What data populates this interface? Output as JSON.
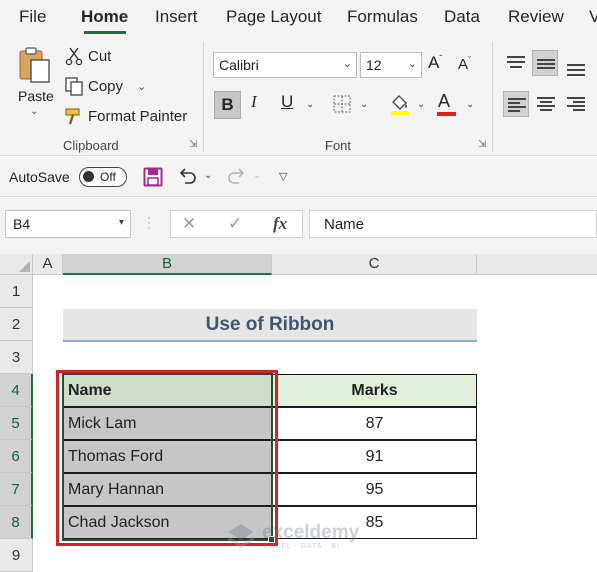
{
  "menu": {
    "tabs": [
      "File",
      "Home",
      "Insert",
      "Page Layout",
      "Formulas",
      "Data",
      "Review",
      "V"
    ],
    "active_tab": "Home"
  },
  "ribbon": {
    "clipboard": {
      "paste_label": "Paste",
      "cut_label": "Cut",
      "copy_label": "Copy",
      "format_painter_label": "Format Painter",
      "group_label": "Clipboard"
    },
    "font": {
      "font_name": "Calibri",
      "font_size": "12",
      "bold_label": "B",
      "italic_label": "I",
      "underline_label": "U",
      "font_color_label": "A",
      "group_label": "Font"
    }
  },
  "qat": {
    "autosave_label": "AutoSave",
    "autosave_state": "Off"
  },
  "formula_bar": {
    "name_box": "B4",
    "fx_label": "fx",
    "value": "Name"
  },
  "sheet": {
    "columns": [
      "A",
      "B",
      "C"
    ],
    "selected_column": "B",
    "rows": [
      "1",
      "2",
      "3",
      "4",
      "5",
      "6",
      "7",
      "8",
      "9"
    ],
    "selected_rows": [
      "4",
      "5",
      "6",
      "7",
      "8"
    ],
    "title": "Use of Ribbon",
    "table": {
      "headers": [
        "Name",
        "Marks"
      ],
      "rows": [
        [
          "Mick Lam",
          "87"
        ],
        [
          "Thomas Ford",
          "91"
        ],
        [
          "Mary Hannan",
          "95"
        ],
        [
          "Chad Jackson",
          "85"
        ]
      ]
    }
  },
  "watermark": {
    "title": "exceldemy",
    "subtitle": "EXCEL · DATA · BI"
  },
  "colors": {
    "excel_green": "#217346",
    "table_header_fill": "#e2efda",
    "title_fill": "#e6e6e6",
    "title_text": "#44546a",
    "highlight_red": "#d52026"
  }
}
